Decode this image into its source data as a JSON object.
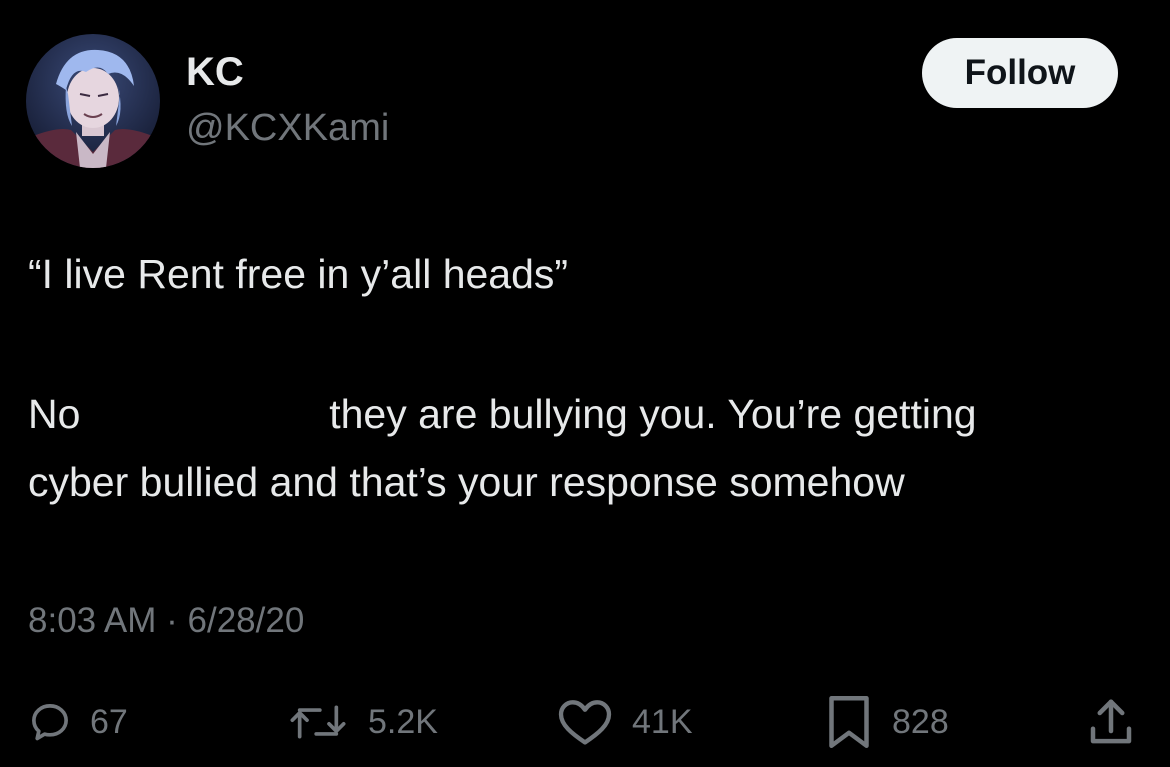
{
  "author": {
    "display_name": "KC",
    "handle": "@KCXKami"
  },
  "follow_label": "Follow",
  "tweet": {
    "quote": "“I live Rent free in y’all heads”",
    "line1_start": "No",
    "line1_end": "they are bullying you. You’re getting",
    "line2": "cyber bullied and that’s your response somehow"
  },
  "timestamp": "8:03 AM · 6/28/20",
  "actions": {
    "replies": "67",
    "retweets": "5.2K",
    "likes": "41K",
    "bookmarks": "828"
  },
  "icons": {
    "reply": "reply-icon",
    "retweet": "retweet-icon",
    "like": "heart-icon",
    "bookmark": "bookmark-icon",
    "share": "share-icon"
  },
  "colors": {
    "background": "#000000",
    "primary_text": "#e7e9ea",
    "secondary_text": "#71767b",
    "follow_button_bg": "#eff3f4",
    "follow_button_text": "#0f1419"
  }
}
